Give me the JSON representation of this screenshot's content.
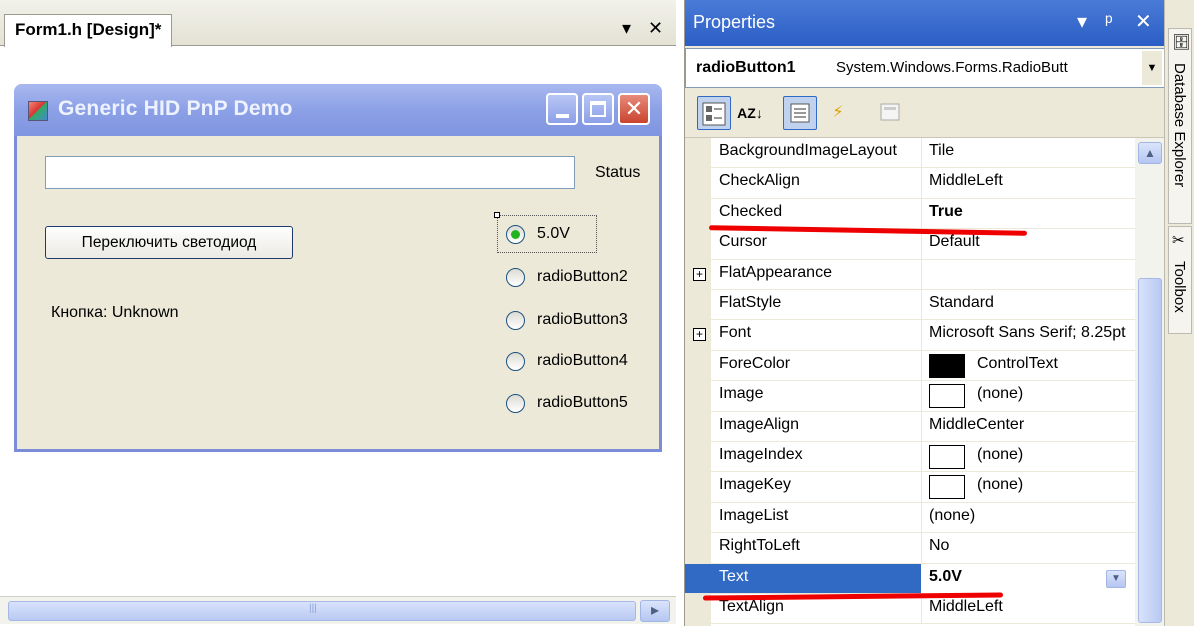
{
  "designer": {
    "tab_label": "Form1.h [Design]*",
    "dropdown_glyph": "▾",
    "close_glyph": "✕"
  },
  "form": {
    "title": "Generic HID PnP Demo",
    "status_input_value": "",
    "status_label": "Status",
    "toggle_button_label": "Переключить светодиод",
    "button_state_label": "Кнопка: Unknown",
    "radios": [
      {
        "label": "5.0V",
        "checked": true
      },
      {
        "label": "radioButton2",
        "checked": false
      },
      {
        "label": "radioButton3",
        "checked": false
      },
      {
        "label": "radioButton4",
        "checked": false
      },
      {
        "label": "radioButton5",
        "checked": false
      }
    ]
  },
  "properties": {
    "title": "Properties",
    "header_controls": {
      "dropdown": "▾",
      "pin": "ᵖ",
      "close": "✕"
    },
    "object_name": "radioButton1",
    "object_type": "System.Windows.Forms.RadioButt",
    "toolbar": {
      "categorized": "categorized-icon",
      "alphabetical": "AZ↓",
      "properties": "properties-icon",
      "events": "events-icon",
      "property_pages": "property-pages-icon"
    },
    "rows": [
      {
        "name": "BackgroundImageLayout",
        "value": "Tile"
      },
      {
        "name": "CheckAlign",
        "value": "MiddleLeft"
      },
      {
        "name": "Checked",
        "value": "True"
      },
      {
        "name": "Cursor",
        "value": "Default"
      },
      {
        "name": "FlatAppearance",
        "value": ""
      },
      {
        "name": "FlatStyle",
        "value": "Standard"
      },
      {
        "name": "Font",
        "value": "Microsoft Sans Serif; 8.25pt"
      },
      {
        "name": "ForeColor",
        "value": "ControlText"
      },
      {
        "name": "Image",
        "value": "(none)"
      },
      {
        "name": "ImageAlign",
        "value": "MiddleCenter"
      },
      {
        "name": "ImageIndex",
        "value": "(none)"
      },
      {
        "name": "ImageKey",
        "value": "(none)"
      },
      {
        "name": "ImageList",
        "value": "(none)"
      },
      {
        "name": "RightToLeft",
        "value": "No"
      },
      {
        "name": "Text",
        "value": "5.0V"
      },
      {
        "name": "TextAlign",
        "value": "MiddleLeft"
      }
    ]
  },
  "side_tabs": {
    "database_explorer": "Database Explorer",
    "toolbox": "Toolbox"
  },
  "colors": {
    "selection": "#316ac5",
    "annotation": "#ee0000",
    "xp_titlebar": "#8ca0e6"
  }
}
